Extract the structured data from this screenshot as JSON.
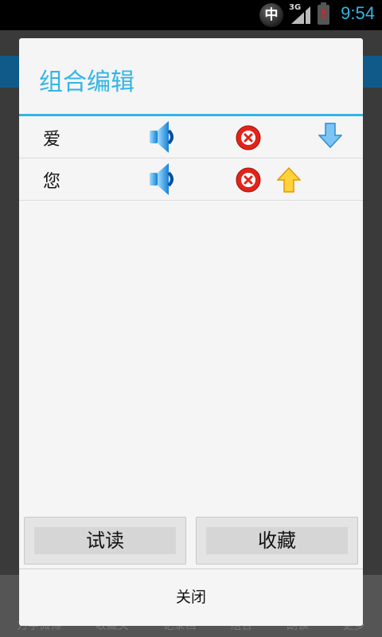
{
  "status_bar": {
    "ime": "中",
    "network": "3G",
    "battery_alert": "!",
    "time": "9:54"
  },
  "dialog": {
    "title": "组合编辑",
    "rows": [
      {
        "word": "爱",
        "icons": [
          "speaker-icon",
          "delete-icon",
          "arrow-down-icon"
        ]
      },
      {
        "word": "您",
        "icons": [
          "speaker-icon",
          "delete-icon",
          "arrow-up-icon"
        ]
      }
    ],
    "try_read_label": "试读",
    "collect_label": "收藏",
    "close_label": "关闭"
  },
  "background_tabs": [
    "方学微博",
    "收藏夹",
    "记录档",
    "组合",
    "朗读",
    "更多"
  ],
  "colors": {
    "accent": "#33b5e5",
    "delete_red": "#e2231a",
    "arrow_blue": "#4aa8e8",
    "arrow_yellow": "#f5b800"
  }
}
